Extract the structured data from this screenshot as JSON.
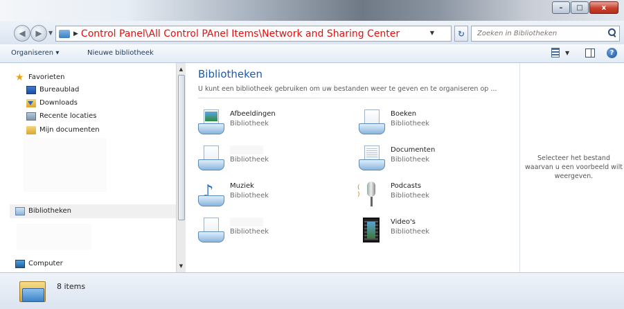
{
  "window": {
    "minimize_glyph": "–",
    "maximize_glyph": "□",
    "close_glyph": "x"
  },
  "address": {
    "path": "Control Panel\\All Control PAnel Items\\Network and Sharing Center",
    "path_color": "#e40f0f"
  },
  "search": {
    "placeholder": "Zoeken in Bibliotheken"
  },
  "toolbar": {
    "organize_label": "Organiseren ▾",
    "new_library_label": "Nieuwe bibliotheek"
  },
  "sidebar": {
    "favorites_label": "Favorieten",
    "items": [
      {
        "label": "Bureaublad",
        "icon": "desktop-icon"
      },
      {
        "label": "Downloads",
        "icon": "downloads-folder-icon"
      },
      {
        "label": "Recente locaties",
        "icon": "recent-places-icon"
      },
      {
        "label": "Mijn documenten",
        "icon": "folder-icon"
      }
    ],
    "libraries_label": "Bibliotheken",
    "computer_label": "Computer"
  },
  "main": {
    "title": "Bibliotheken",
    "description": "U kunt een bibliotheek gebruiken om uw bestanden weer te geven en te organiseren op ...",
    "title_color": "#1e5aa8",
    "libraries": [
      {
        "name": "Afbeeldingen",
        "type": "Bibliotheek",
        "icon": "pictures-library-icon"
      },
      {
        "name": "Boeken",
        "type": "Bibliotheek",
        "icon": "books-library-icon"
      },
      {
        "name": "",
        "type": "Bibliotheek",
        "icon": "library-icon"
      },
      {
        "name": "Documenten",
        "type": "Bibliotheek",
        "icon": "documents-library-icon"
      },
      {
        "name": "Muziek",
        "type": "Bibliotheek",
        "icon": "music-library-icon"
      },
      {
        "name": "Podcasts",
        "type": "Bibliotheek",
        "icon": "podcasts-library-icon"
      },
      {
        "name": "",
        "type": "Bibliotheek",
        "icon": "library-icon"
      },
      {
        "name": "Video's",
        "type": "Bibliotheek",
        "icon": "videos-library-icon"
      }
    ]
  },
  "preview": {
    "text": "Selecteer het bestand waarvan u een voorbeeld wilt weergeven."
  },
  "status": {
    "count_text": "8 items"
  }
}
